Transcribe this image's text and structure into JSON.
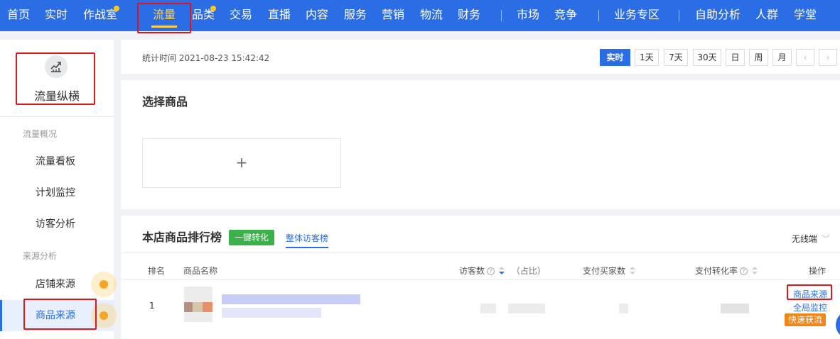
{
  "topnav": {
    "items": [
      {
        "label": "首页"
      },
      {
        "label": "实时"
      },
      {
        "label": "作战室"
      },
      {
        "label": "流量"
      },
      {
        "label": "品类"
      },
      {
        "label": "交易"
      },
      {
        "label": "直播"
      },
      {
        "label": "内容"
      },
      {
        "label": "服务"
      },
      {
        "label": "营销"
      },
      {
        "label": "物流"
      },
      {
        "label": "财务"
      },
      {
        "label": "市场"
      },
      {
        "label": "竞争"
      },
      {
        "label": "业务专区"
      },
      {
        "label": "自助分析"
      },
      {
        "label": "人群"
      },
      {
        "label": "学堂"
      }
    ],
    "active": "流量"
  },
  "sidebar": {
    "title": "流量纵横",
    "icon": "traffic-chart-icon",
    "groups": [
      {
        "label": "流量概况",
        "items": [
          "流量看板",
          "计划监控",
          "访客分析"
        ]
      },
      {
        "label": "来源分析",
        "items": [
          "店铺来源",
          "商品来源"
        ]
      }
    ],
    "active": "商品来源"
  },
  "header": {
    "stat_time": "统计时间 2021-08-23 15:42:42",
    "time_buttons": [
      "实时",
      "1天",
      "7天",
      "30天",
      "日",
      "周",
      "月"
    ],
    "active_time": "实时",
    "prev_icon": "chevron-left-icon",
    "next_icon": "chevron-right-icon"
  },
  "select_product": {
    "title": "选择商品",
    "add_symbol": "+"
  },
  "ranking": {
    "title": "本店商品排行榜",
    "convert_tag": "一键转化",
    "tab": "整体访客榜",
    "device": "无线端",
    "columns": {
      "rank": "排名",
      "name": "商品名称",
      "visitors": "访客数",
      "share": "（占比）",
      "buyers": "支付买家数",
      "conv": "支付转化率",
      "ops": "操作"
    },
    "rows": [
      {
        "rank": "1",
        "ops": [
          "商品来源",
          "全局监控"
        ],
        "quick": "快速获流"
      }
    ]
  },
  "colors": {
    "nav_blue": "#2b6de5",
    "active_yellow": "#ffd24d",
    "green_tag": "#3cb04a",
    "orange_tag": "#f08519",
    "highlight_red": "#e0161d"
  }
}
